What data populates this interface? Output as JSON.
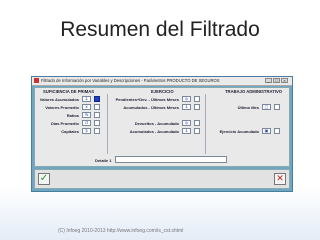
{
  "slide": {
    "title": "Resumen del Filtrado",
    "footer": "(C) Infoeg 2010-2013 http://www.infoeg.com/is_cst.shtml"
  },
  "window": {
    "title": "Filtrado de Información por Variables y Descripciones - Parámetros PRODUCTO DE SEGUROS",
    "buttons": {
      "minimize": "_",
      "maximize": "□",
      "close": "×"
    }
  },
  "sections": {
    "suficiencia": {
      "title": "SUFICIENCIA DE PRIMAS",
      "rows": [
        {
          "label": "Valores Acumulados",
          "symbol": "Σ"
        },
        {
          "label": "Valores Promedio",
          "symbol": "x̄"
        },
        {
          "label": "Ratios",
          "symbol": "%"
        },
        {
          "label": "Días Promedio",
          "symbol": "d"
        },
        {
          "label": "Capitales",
          "symbol": "$"
        }
      ]
    },
    "ejercicio": {
      "title": "EJERCICIO",
      "rows": [
        {
          "label": "Pendientes+Dev. - Últimos Meses",
          "symbol": "◎"
        },
        {
          "label": "Acumulados - Últimos Meses",
          "symbol": "Σ"
        },
        {
          "label": "Devueltos - Acumulado",
          "symbol": "◎"
        },
        {
          "label": "Acumulados - Acumulado",
          "symbol": "Σ"
        }
      ]
    },
    "trabajo": {
      "title": "TRABAJO ADMINISTRATIVO",
      "rows": [
        {
          "label": "Último Mes",
          "symbol": "□"
        },
        {
          "label": "Ejercicio Acumulado",
          "symbol": "▣"
        }
      ]
    }
  },
  "detalle": {
    "label": "Detalle 1",
    "value": ""
  },
  "actions": {
    "ok_symbol": "✓",
    "cancel_symbol": "✕"
  }
}
